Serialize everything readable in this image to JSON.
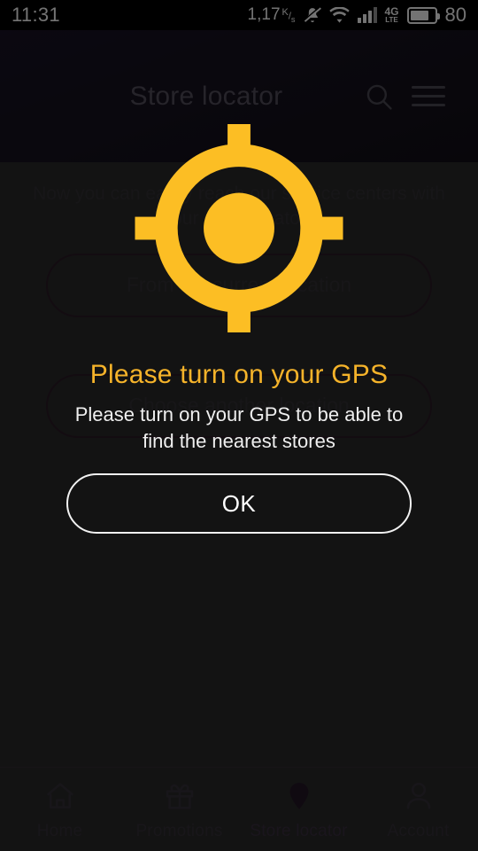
{
  "status_bar": {
    "time": "11:31",
    "network_speed": "1,17",
    "network_speed_unit_num": "K",
    "network_speed_unit_den": "s",
    "battery_percent": "80",
    "network_type": "4G",
    "network_type_sub": "LTE",
    "icons": [
      "bell-muted-icon",
      "wifi-icon",
      "signal-icon",
      "4g-lte-icon",
      "battery-icon"
    ]
  },
  "app_bar": {
    "title": "Store locator",
    "search_icon": "search-icon",
    "menu_icon": "hamburger-menu-icon"
  },
  "page": {
    "promo_text": "Now you can easily reach our service centers with our store locator",
    "current_location_button": "From my current location",
    "another_location_button": "Choose another location"
  },
  "dialog": {
    "icon": "gps-crosshair-icon",
    "title": "Please turn on your GPS",
    "message": "Please turn on your GPS to be able to find the nearest stores",
    "ok_label": "OK",
    "accent_color": "#f5b32a"
  },
  "bottom_nav": {
    "items": [
      {
        "label": "Home",
        "icon": "home-icon",
        "active": false
      },
      {
        "label": "Promotions",
        "icon": "gift-icon",
        "active": false
      },
      {
        "label": "Store locator",
        "icon": "map-pin-icon",
        "active": true
      },
      {
        "label": "Account",
        "icon": "person-icon",
        "active": false
      }
    ]
  }
}
